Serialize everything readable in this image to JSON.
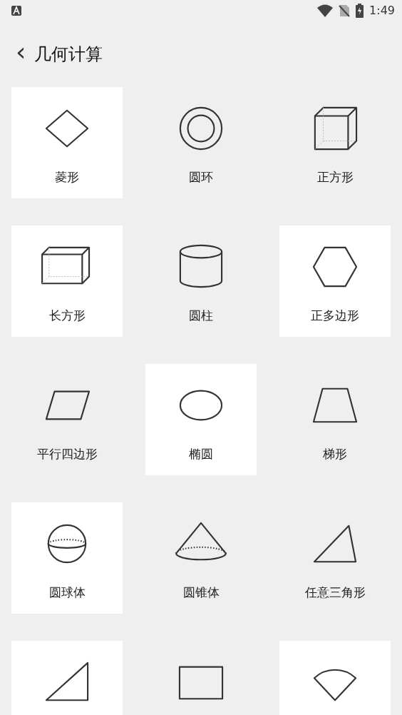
{
  "status_bar": {
    "time": "1:49"
  },
  "header": {
    "back": "‹",
    "title": "几何计算"
  },
  "shapes": [
    {
      "label": "菱形",
      "highlighted": true
    },
    {
      "label": "圆环",
      "highlighted": false
    },
    {
      "label": "正方形",
      "highlighted": false
    },
    {
      "label": "长方形",
      "highlighted": true
    },
    {
      "label": "圆柱",
      "highlighted": false
    },
    {
      "label": "正多边形",
      "highlighted": true
    },
    {
      "label": "平行四边形",
      "highlighted": false
    },
    {
      "label": "椭圆",
      "highlighted": true
    },
    {
      "label": "梯形",
      "highlighted": false
    },
    {
      "label": "圆球体",
      "highlighted": true
    },
    {
      "label": "圆锥体",
      "highlighted": false
    },
    {
      "label": "任意三角形",
      "highlighted": false
    },
    {
      "highlighted": true
    },
    {
      "highlighted": false
    },
    {
      "highlighted": true
    }
  ]
}
